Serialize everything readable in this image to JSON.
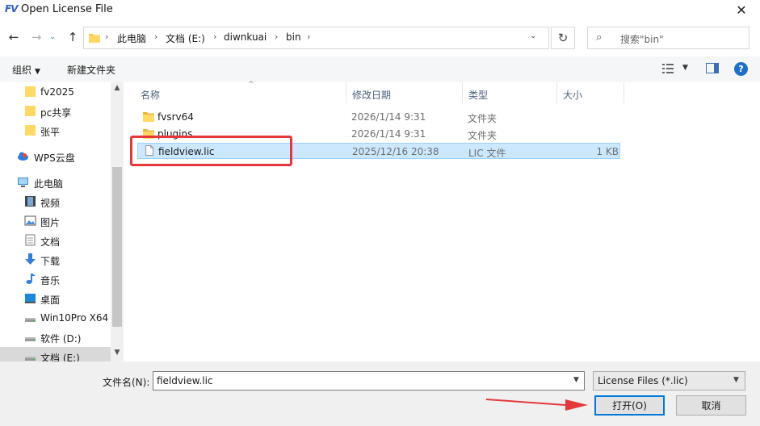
{
  "window": {
    "title": "Open License File",
    "app_icon_text": "FV"
  },
  "nav": {
    "path": [
      "此电脑",
      "文档 (E:)",
      "diwnkuai",
      "bin"
    ],
    "search_placeholder": "搜索\"bin\""
  },
  "toolbar": {
    "organize": "组织",
    "new_folder": "新建文件夹"
  },
  "sidebar": {
    "items": [
      {
        "label": "fv2025",
        "icon": "folder-icon"
      },
      {
        "label": "pc共享",
        "icon": "folder-icon"
      },
      {
        "label": "张平",
        "icon": "folder-icon"
      },
      {
        "label": "WPS云盘",
        "icon": "cloud-icon"
      },
      {
        "label": "此电脑",
        "icon": "computer-icon"
      },
      {
        "label": "视频",
        "icon": "video-icon"
      },
      {
        "label": "图片",
        "icon": "picture-icon"
      },
      {
        "label": "文档",
        "icon": "document-icon"
      },
      {
        "label": "下载",
        "icon": "download-icon"
      },
      {
        "label": "音乐",
        "icon": "music-icon"
      },
      {
        "label": "桌面",
        "icon": "desktop-icon"
      },
      {
        "label": "Win10Pro X64",
        "icon": "drive-icon"
      },
      {
        "label": "软件 (D:)",
        "icon": "drive-icon"
      },
      {
        "label": "文档 (E:)",
        "icon": "drive-icon",
        "selected": true
      }
    ]
  },
  "columns": {
    "name": "名称",
    "date": "修改日期",
    "type": "类型",
    "size": "大小"
  },
  "files": [
    {
      "name": "fvsrv64",
      "date": "2026/1/14 9:31",
      "type": "文件夹",
      "size": "",
      "icon": "folder-icon"
    },
    {
      "name": "plugins",
      "date": "2026/1/14 9:31",
      "type": "文件夹",
      "size": "",
      "icon": "folder-icon"
    },
    {
      "name": "fieldview.lic",
      "date": "2025/12/16 20:38",
      "type": "LIC 文件",
      "size": "1 KB",
      "icon": "file-icon",
      "selected": true
    }
  ],
  "bottom": {
    "filename_label": "文件名(N):",
    "filename_value": "fieldview.lic",
    "filter_value": "License Files (*.lic)",
    "open_label": "打开(O)",
    "cancel_label": "取消"
  },
  "colors": {
    "accent": "#0078d7",
    "selection": "#cce8ff",
    "annotation": "#e5383b"
  }
}
